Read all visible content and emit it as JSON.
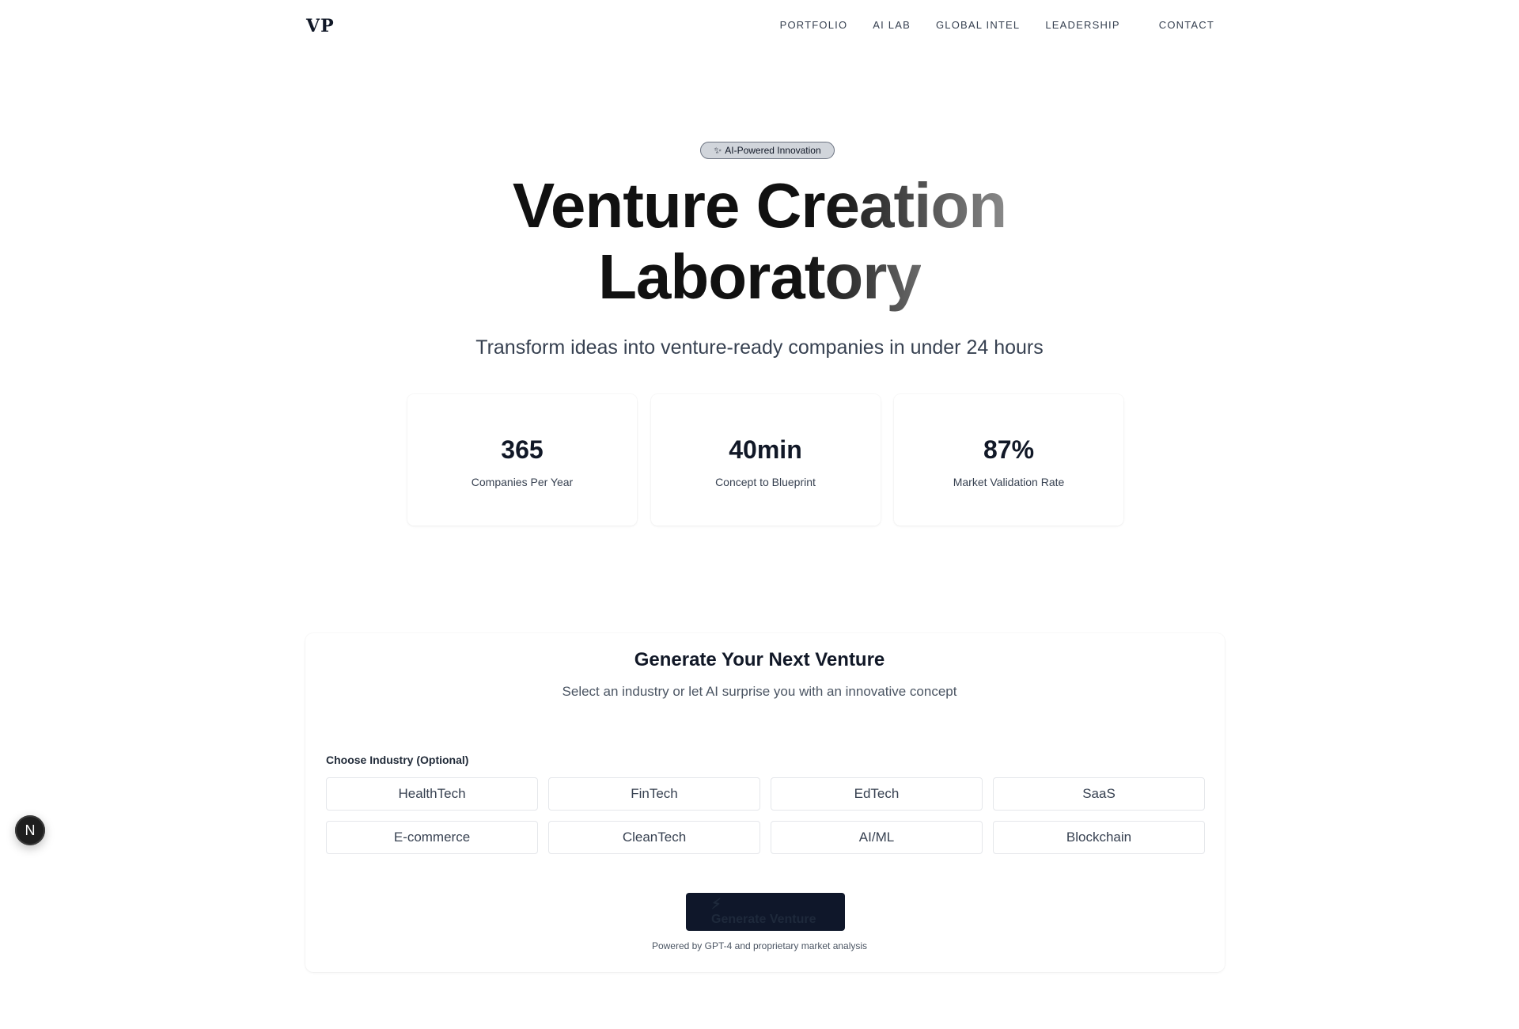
{
  "nav": {
    "logo": "VP",
    "links": [
      "PORTFOLIO",
      "AI LAB",
      "GLOBAL INTEL",
      "LEADERSHIP"
    ],
    "contact": "CONTACT"
  },
  "hero": {
    "badge": "AI-Powered Innovation",
    "badge_icon": "sparkles-icon",
    "title_line1_a": "Venture Cr",
    "title_line1_b": "eation",
    "title_line2_a": "Labora",
    "title_line2_b": "tory",
    "subtitle": "Transform ideas into venture-ready companies in under 24 hours"
  },
  "stats": [
    {
      "value": "365",
      "label": "Companies Per Year"
    },
    {
      "value": "40min",
      "label": "Concept to Blueprint"
    },
    {
      "value": "87%",
      "label": "Market Validation Rate"
    }
  ],
  "generator": {
    "title": "Generate Your Next Venture",
    "subtitle": "Select an industry or let AI surprise you with an innovative concept",
    "choose_label": "Choose Industry (Optional)",
    "industries": [
      "HealthTech",
      "FinTech",
      "EdTech",
      "SaaS",
      "E-commerce",
      "CleanTech",
      "AI/ML",
      "Blockchain"
    ],
    "button_label": "Generate Venture",
    "button_icon": "lightning-icon",
    "powered_by": "Powered by GPT-4 and proprietary market analysis"
  },
  "floating": {
    "label": "N"
  },
  "colors": {
    "primary_dark": "#0f172a",
    "badge_bg": "#d1d5db",
    "text_muted": "#374151"
  }
}
